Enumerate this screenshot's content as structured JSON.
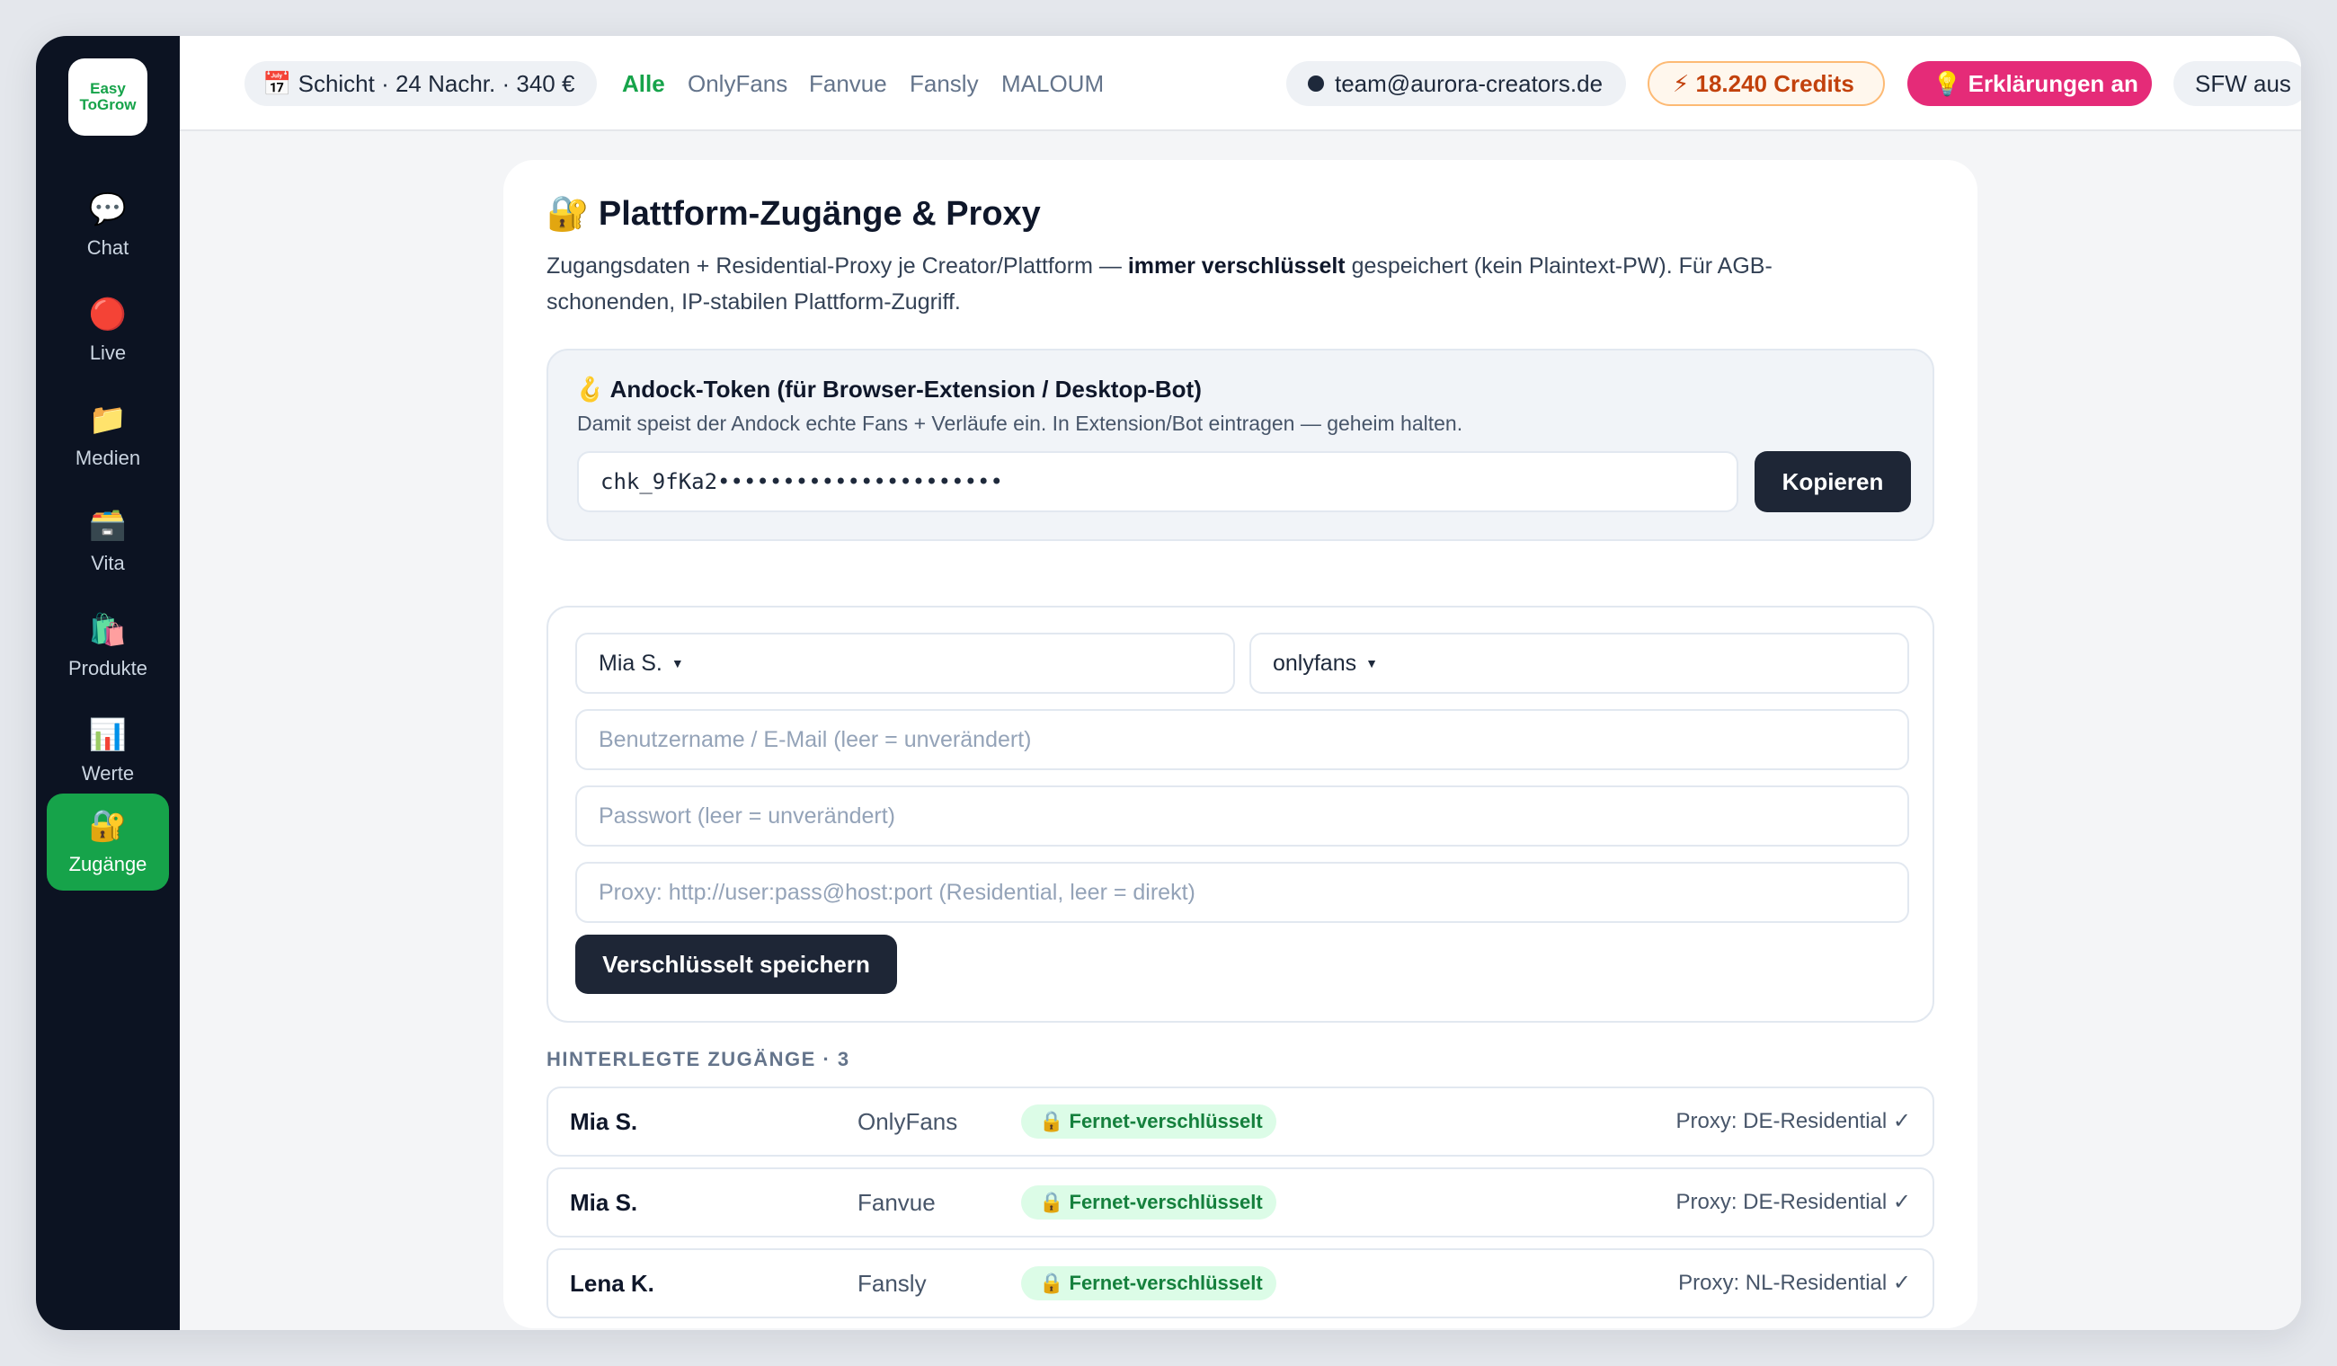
{
  "app": {
    "logo_line1": "Easy",
    "logo_line2": "ToGrow"
  },
  "sidebar": {
    "items": [
      {
        "icon": "💬",
        "label": "Chat"
      },
      {
        "icon": "🔴",
        "label": "Live"
      },
      {
        "icon": "📁",
        "label": "Medien"
      },
      {
        "icon": "🗃️",
        "label": "Vita"
      },
      {
        "icon": "🛍️",
        "label": "Produkte"
      },
      {
        "icon": "📊",
        "label": "Werte"
      },
      {
        "icon": "🔐",
        "label": "Zugänge"
      }
    ],
    "active_index": 6
  },
  "topbar": {
    "shift": "📅 Schicht · 24 Nachr. · 340 €",
    "filters": [
      "Alle",
      "OnlyFans",
      "Fanvue",
      "Fansly",
      "MALOUM"
    ],
    "active_filter": "Alle",
    "email": "team@aurora-creators.de",
    "credits": "⚡ 18.240 Credits",
    "explain": "💡 Erklärungen an",
    "sfw": "SFW aus"
  },
  "main": {
    "title": "🔐 Plattform-Zugänge & Proxy",
    "desc_pre": "Zugangsdaten + Residential-Proxy je Creator/Plattform — ",
    "desc_bold": "immer verschlüsselt",
    "desc_post": " gespeichert (kein Plaintext-PW). Für AGB-schonenden, IP-stabilen Plattform-Zugriff.",
    "token": {
      "title": "🪝 Andock-Token (für Browser-Extension / Desktop-Bot)",
      "subtitle": "Damit speist der Andock echte Fans + Verläufe ein. In Extension/Bot eintragen — geheim halten.",
      "value": "chk_9fKa2••••••••••••••••••••••",
      "copy_label": "Kopieren"
    },
    "form": {
      "creator": "Mia S.",
      "platform": "onlyfans",
      "username_placeholder": "Benutzername / E-Mail (leer = unverändert)",
      "password_placeholder": "Passwort (leer = unverändert)",
      "proxy_placeholder": "Proxy: http://user:pass@host:port (Residential, leer = direkt)",
      "save_label": "Verschlüsselt speichern"
    },
    "list_heading": "HINTERLEGTE ZUGÄNGE · 3",
    "accounts": [
      {
        "name": "Mia S.",
        "platform": "OnlyFans",
        "badge": "🔒 Fernet-verschlüsselt",
        "proxy": "Proxy: DE-Residential ✓"
      },
      {
        "name": "Mia S.",
        "platform": "Fanvue",
        "badge": "🔒 Fernet-verschlüsselt",
        "proxy": "Proxy: DE-Residential ✓"
      },
      {
        "name": "Lena K.",
        "platform": "Fansly",
        "badge": "🔒 Fernet-verschlüsselt",
        "proxy": "Proxy: NL-Residential ✓"
      }
    ]
  },
  "colors": {
    "sidebar_bg": "#0c1322",
    "accent_green": "#16a34a",
    "pink": "#e52b78",
    "credits_orange": "#c2410c",
    "dark_button": "#1e2636"
  }
}
